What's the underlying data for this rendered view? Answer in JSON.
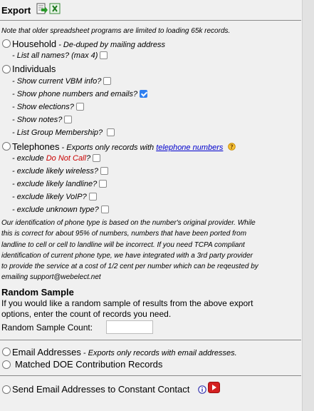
{
  "export": {
    "title": "Export",
    "icons": [
      "export-icon",
      "excel-icon"
    ],
    "note": "Note that older spreadsheet programs are limited to loading 65k records."
  },
  "household": {
    "label": "Household",
    "desc": " - De-duped by mailing address",
    "options": [
      {
        "label": "- List all names? (max 4)",
        "checked": false
      }
    ]
  },
  "individuals": {
    "label": "Individuals",
    "options": [
      {
        "label": "- Show current VBM info?",
        "checked": false
      },
      {
        "label": "- Show phone numbers and emails?",
        "checked": true
      },
      {
        "label": "- Show elections?",
        "checked": false
      },
      {
        "label": "- Show notes?",
        "checked": false
      },
      {
        "label": "- List Group Membership?",
        "checked": false
      }
    ]
  },
  "telephones": {
    "label": "Telephones",
    "desc": " - Exports only records with ",
    "link": "telephone numbers",
    "help_icon": "help-icon",
    "options": [
      {
        "prefix": "- exclude ",
        "highlight": "Do Not Call",
        "suffix": "?",
        "checked": false
      },
      {
        "prefix": "- exclude likely wireless?",
        "checked": false
      },
      {
        "prefix": "- exclude likely landline?",
        "checked": false
      },
      {
        "prefix": "- exclude likely VoIP?",
        "checked": false
      },
      {
        "prefix": "- exclude unknown type?",
        "checked": false
      }
    ],
    "paragraph": [
      "Our identification of phone type is based on the number's original provider. While",
      "this is correct for about 95% of numbers, numbers that have been ported from",
      "landline to cell or cell to landline will be incorrect. If you need TCPA compliant",
      "identification of current phone type, we have integrated with a 3rd party provider",
      "to provide the service at a cost of 1/2 cent per number which can be reqeusted by",
      "emailing support@webelect.net"
    ]
  },
  "random_sample": {
    "title": "Random Sample",
    "desc_lines": [
      "If you would like a random sample of results from the above export",
      "options, enter the count of records you need."
    ],
    "count_label": "Random Sample Count:",
    "count_value": ""
  },
  "email_addresses": {
    "label": "Email Addresses",
    "desc": " - Exports only records with email addresses."
  },
  "doe": {
    "label": "Matched DOE Contribution Records"
  },
  "constant_contact": {
    "label": "Send Email Addresses to Constant Contact",
    "icons": [
      "info-icon",
      "play-icon"
    ]
  },
  "colors": {
    "accent_blue": "#2f7ff0",
    "link": "#0000cc",
    "warning_red": "#c80000",
    "help_orange": "#f0a000",
    "play_red": "#d42020"
  }
}
